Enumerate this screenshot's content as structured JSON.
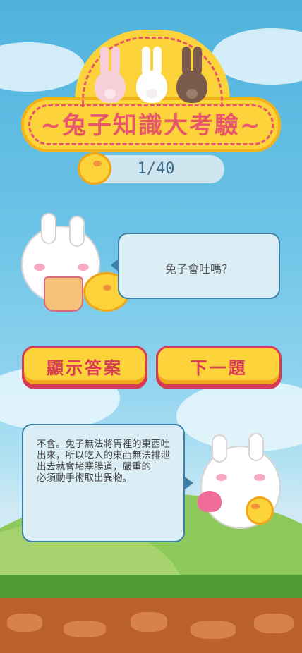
{
  "title": "~兔子知識大考驗~",
  "progress": "1/40",
  "question": "兔子會吐嗎？",
  "buttons": {
    "show_answer": "顯示答案",
    "next": "下一題"
  },
  "answer": "不會。兔子無法將胃裡的東西吐出來，所以吃入的東西無法排泄出去就會堵塞腸道，嚴重的　　必須動手術取出異物。",
  "colors": {
    "banner": "#fcd33a",
    "accent": "#e8566b",
    "bubble": "#dbeef6",
    "bubble_border": "#3e7fa8"
  }
}
